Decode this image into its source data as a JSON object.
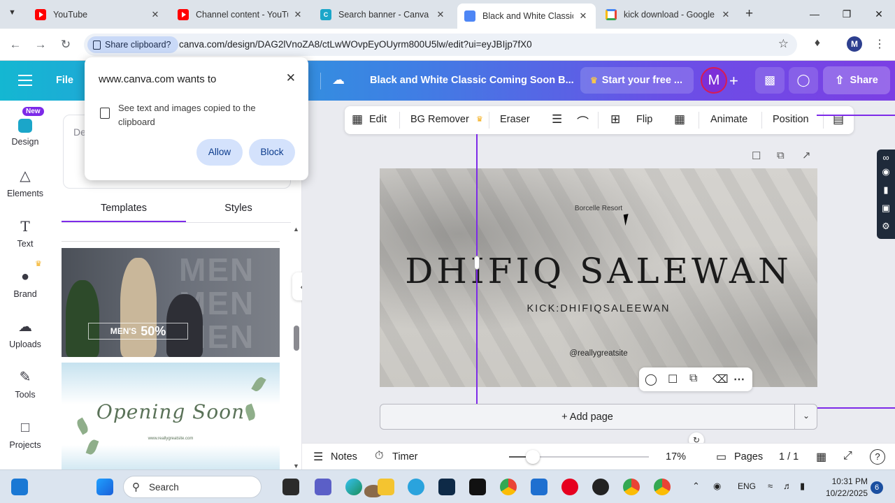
{
  "browser": {
    "tabs": [
      {
        "title": "YouTube"
      },
      {
        "title": "Channel content - YouTube"
      },
      {
        "title": "Search banner - Canva"
      },
      {
        "title": "Black and White Classic Coming Soon Banner"
      },
      {
        "title": "kick download - Google Search"
      }
    ],
    "share_clipboard": "Share clipboard?",
    "url": "canva.com/design/DAG2lVnoZA8/ctLwWOvpEyOUyrm800U5lw/edit?ui=eyJBIjp7fX0",
    "profile_initial": "M"
  },
  "permission_popup": {
    "title": "www.canva.com wants to",
    "text": "See text and images copied to the clipboard",
    "allow": "Allow",
    "block": "Block"
  },
  "header": {
    "file": "File",
    "doc_title": "Black and White Classic Coming Soon B...",
    "trial": "Start your free ...",
    "avatar": "M",
    "share": "Share"
  },
  "rail": {
    "new_badge": "New",
    "items": [
      "Design",
      "Elements",
      "Text",
      "Brand",
      "Uploads",
      "Tools",
      "Projects"
    ]
  },
  "panel": {
    "search_placeholder": "De",
    "tabs": [
      "Templates",
      "Styles"
    ],
    "mens_big": "MEN",
    "mens_label": "MEN'S",
    "mens_discount": "50%",
    "opening_title": "Opening Soon",
    "opening_url": "www.reallygreatsite.com"
  },
  "toolbar": {
    "edit": "Edit",
    "bg_remover": "BG Remover",
    "eraser": "Eraser",
    "flip": "Flip",
    "animate": "Animate",
    "position": "Position"
  },
  "canvas": {
    "brand": "Borcelle Resort",
    "headline": "DHIFIQ SALEWAN",
    "subline": "KICK:DHIFIQSALEEWAN",
    "site": "@reallygreatsite"
  },
  "add_page": "+ Add page",
  "bottom": {
    "notes": "Notes",
    "timer": "Timer",
    "zoom_percent": "17%",
    "zoom_level": 0.17,
    "pages": "Pages",
    "page_count": "1 / 1"
  },
  "taskbar": {
    "search": "Search",
    "lang": "ENG",
    "time": "10:31 PM",
    "date": "10/22/2025",
    "notifications": "6"
  },
  "colors": {
    "accent": "#7d2ae8",
    "header_start": "#14b7d2",
    "header_end": "#7b3fe4"
  }
}
